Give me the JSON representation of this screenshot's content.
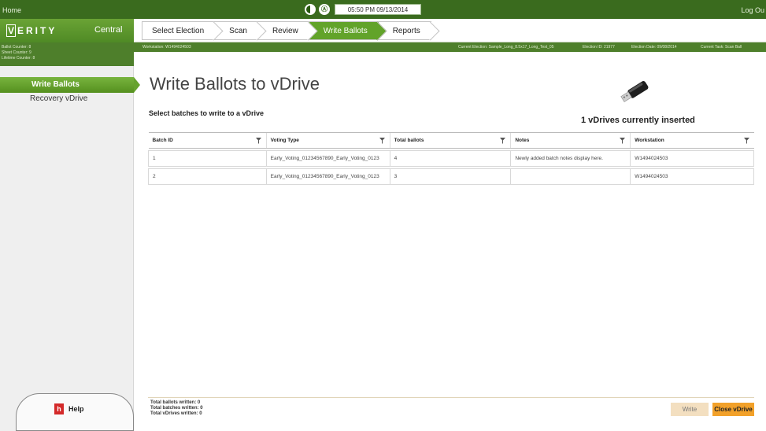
{
  "topbar": {
    "home_label": "Home",
    "logout_label": "Log Ou",
    "accessibility_symbol": "Ⓐ",
    "datetime": "05:50 PM 09/13/2014"
  },
  "brand": {
    "logo_first": "V",
    "logo_rest": "ERITY",
    "app_name": "Central"
  },
  "steps": [
    {
      "label": "Select Election"
    },
    {
      "label": "Scan"
    },
    {
      "label": "Review"
    },
    {
      "label": "Write Ballots"
    },
    {
      "label": "Reports"
    }
  ],
  "counters": {
    "ballot": "Ballot Counter: 8",
    "sheet": "Sheet Counter: 9",
    "lifetime": "Lifetime Counter: 8"
  },
  "strip": {
    "workstation": "Workstation: W1494024503",
    "current_election": "Current Election: Sample_Long_8.5x17_Long_Test_05",
    "election_id": "Election ID: 21977",
    "election_date": "Election Date: 09/08/2014",
    "current_task": "Current Task: Scan Ball"
  },
  "sidebar": {
    "items": [
      {
        "label": "Write Ballots"
      },
      {
        "label": "Recovery vDrive"
      }
    ],
    "help_label": "Help",
    "help_glyph": "h"
  },
  "main": {
    "title": "Write Ballots to vDrive",
    "subtitle": "Select batches to write to a vDrive",
    "vdrive_status": "1 vDrives currently inserted"
  },
  "table": {
    "headers": [
      "Batch ID",
      "Voting Type",
      "Total ballots",
      "Notes",
      "Workstation"
    ],
    "rows": [
      [
        "1",
        "Early_Voting_01234567890_Early_Voting_0123",
        "4",
        "Newly added batch notes display here.",
        "W1494024503"
      ],
      [
        "2",
        "Early_Voting_01234567890_Early_Voting_0123",
        "3",
        "",
        "W1494024503"
      ]
    ]
  },
  "totals": {
    "ballots": "Total ballots written: 0",
    "batches": "Total batches written: 0",
    "vdrives": "Total vDrives written: 0"
  },
  "buttons": {
    "write": "Write",
    "close_vdrive": "Close vDrive"
  },
  "colors": {
    "topbar": "#3a6b1e",
    "accent_green": "#62a32a",
    "close_button": "#f2a12a",
    "write_button_disabled": "#f3dfc0"
  }
}
